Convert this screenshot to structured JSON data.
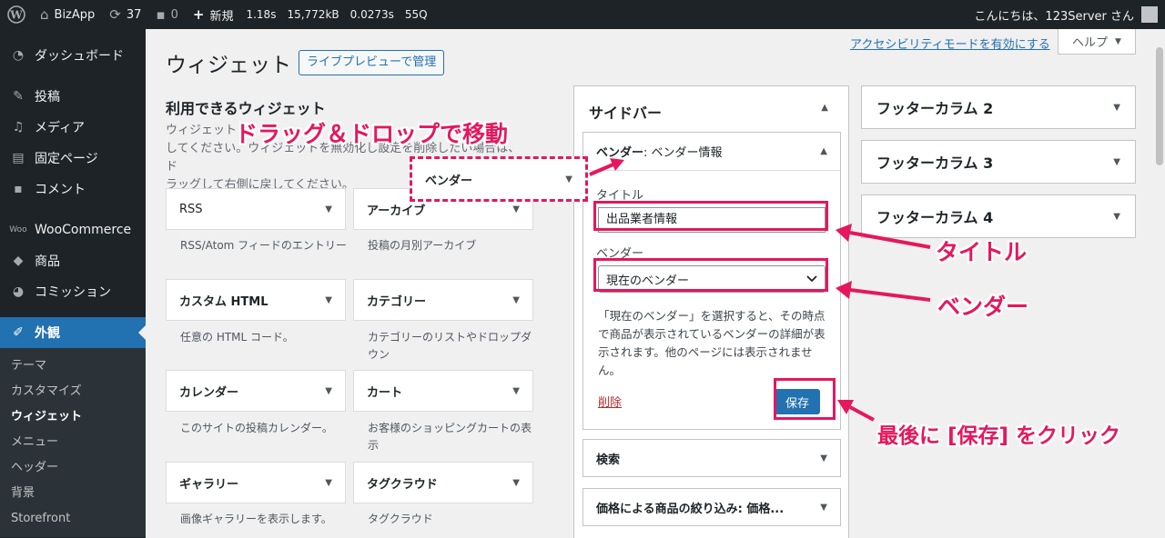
{
  "adminbar": {
    "site_name": "BizApp",
    "updates_count": "37",
    "comments_count": "0",
    "new_label": "新規",
    "stat_time": "1.18s",
    "stat_mem": "15,772kB",
    "stat_query_time": "0.0273s",
    "stat_queries": "55Q",
    "greeting": "こんにちは、123Server さん"
  },
  "sidebar": {
    "items": [
      {
        "label": "ダッシュボード",
        "icon": "dashboard-icon"
      },
      {
        "label": "投稿",
        "icon": "pin-icon"
      },
      {
        "label": "メディア",
        "icon": "media-icon"
      },
      {
        "label": "固定ページ",
        "icon": "page-icon"
      },
      {
        "label": "コメント",
        "icon": "comment-icon"
      },
      {
        "label": "WooCommerce",
        "icon": "woocommerce-icon"
      },
      {
        "label": "商品",
        "icon": "box-icon"
      },
      {
        "label": "コミッション",
        "icon": "pie-icon"
      },
      {
        "label": "外観",
        "icon": "brush-icon"
      }
    ],
    "submenu": [
      "テーマ",
      "カスタマイズ",
      "ウィジェット",
      "メニュー",
      "ヘッダー",
      "背景",
      "Storefront"
    ]
  },
  "header": {
    "title": "ウィジェット",
    "live_preview": "ライブプレビューで管理",
    "a11y_link": "アクセシビリティモードを有効にする",
    "help": "ヘルプ"
  },
  "available": {
    "title": "利用できるウィジェット",
    "desc_line1": "ウィジェット",
    "desc_line2": "してください。ウィジェットを無効化し設定を削除したい場合は、ド",
    "desc_line3": "ラッグして右側に戻してください。",
    "widgets": [
      {
        "name": "RSS",
        "desc": "RSS/Atom フィードのエントリー"
      },
      {
        "name": "アーカイブ",
        "desc": "投稿の月別アーカイブ"
      },
      {
        "name": "カスタム HTML",
        "desc": "任意の HTML コード。"
      },
      {
        "name": "カテゴリー",
        "desc": "カテゴリーのリストやドロップダウン"
      },
      {
        "name": "カレンダー",
        "desc": "このサイトの投稿カレンダー。"
      },
      {
        "name": "カート",
        "desc": "お客様のショッピングカートの表示"
      },
      {
        "name": "ギャラリー",
        "desc": "画像ギャラリーを表示します。"
      },
      {
        "name": "タグクラウド",
        "desc": "タグクラウド"
      }
    ]
  },
  "sidebar_area": {
    "title": "サイドバー",
    "open_widget": {
      "name": "ベンダー",
      "subtitle": ": ベンダー情報",
      "title_label": "タイトル",
      "title_value": "出品業者情報",
      "vendor_label": "ベンダー",
      "vendor_value": "現在のベンダー",
      "help_text": "「現在のベンダー」を選択すると、その時点で商品が表示されているベンダーの詳細が表示されます。他のページには表示されません。",
      "delete": "削除",
      "save": "保存"
    },
    "closed_widgets": [
      "検索",
      "価格による商品の絞り込み: 価格..."
    ]
  },
  "footer_areas": [
    "フッターカラム 2",
    "フッターカラム 3",
    "フッターカラム 4"
  ],
  "annotations": {
    "drag": "ドラッグ＆ドロップで移動",
    "dragged_widget": "ベンダー",
    "title": "タイトル",
    "vendor": "ベンダー",
    "save": "最後に [保存] をクリック"
  },
  "colors": {
    "accent": "#e6175c",
    "primary": "#2271b1",
    "admin_dark": "#1d2327"
  }
}
